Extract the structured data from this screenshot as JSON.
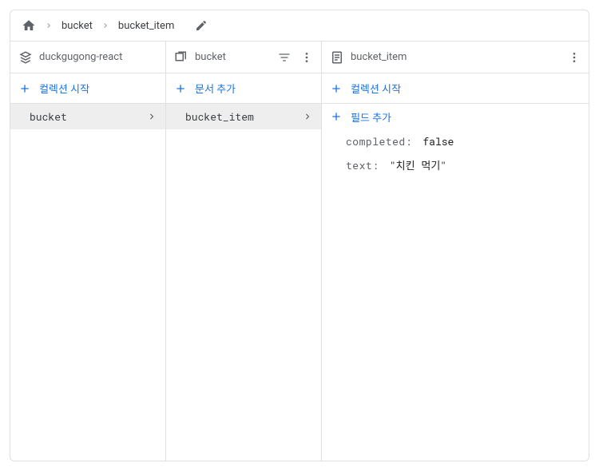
{
  "breadcrumb": {
    "seg1": "bucket",
    "seg2": "bucket_item"
  },
  "col1": {
    "title": "duckgugong-react",
    "add_label": "컬렉션 시작",
    "item": "bucket"
  },
  "col2": {
    "title": "bucket",
    "add_label": "문서 추가",
    "item": "bucket_item"
  },
  "col3": {
    "title": "bucket_item",
    "add_label": "컬렉션 시작",
    "field_add_label": "필드 추가",
    "fields": {
      "f0_key": "completed",
      "f0_val": "false",
      "f1_key": "text",
      "f1_val": "\"치킨 먹기\""
    }
  }
}
